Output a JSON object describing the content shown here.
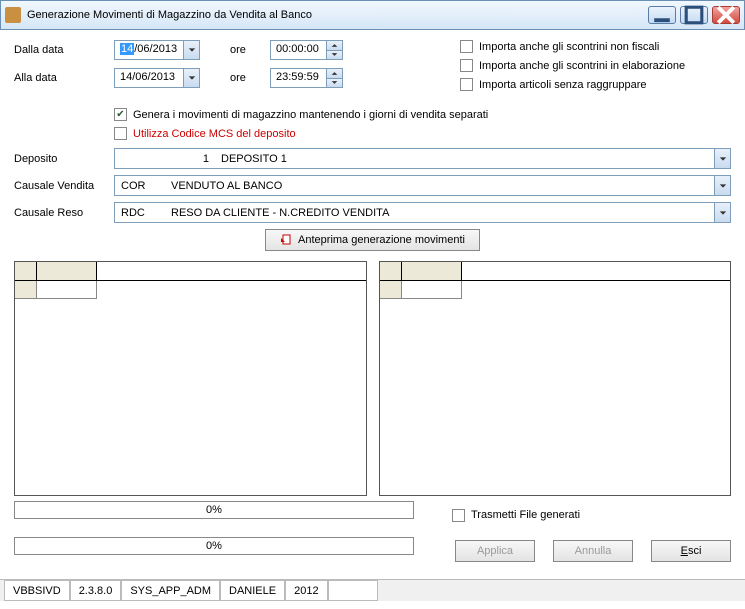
{
  "window": {
    "title": "Generazione Movimenti di Magazzino da Vendita al Banco"
  },
  "dates": {
    "from_label": "Dalla data",
    "from_highlight": "14",
    "from_rest": "/06/2013",
    "to_label": "Alla data",
    "to_value": "14/06/2013",
    "time_label": "ore",
    "time_from": "00:00:00",
    "time_to": "23:59:59"
  },
  "checks": {
    "nonfiscal": "Importa anche gli scontrini non fiscali",
    "elaborazione": "Importa anche gli scontrini in elaborazione",
    "senzaragg": "Importa articoli senza raggruppare",
    "genera": "Genera i movimenti di magazzino mantenendo i giorni di vendita separati",
    "mcs": "Utilizza Codice MCS del deposito",
    "trasmetti": "Trasmetti File generati"
  },
  "deposito": {
    "label": "Deposito",
    "num": "1",
    "text": "DEPOSITO 1"
  },
  "causale_vendita": {
    "label": "Causale Vendita",
    "code": "COR",
    "text": "VENDUTO AL BANCO"
  },
  "causale_reso": {
    "label": "Causale Reso",
    "code": "RDC",
    "text": "RESO DA CLIENTE - N.CREDITO VENDITA"
  },
  "buttons": {
    "anteprima": "Anteprima generazione movimenti",
    "applica": "Applica",
    "annulla": "Annulla",
    "esci_u": "E",
    "esci_rest": "sci"
  },
  "progress": {
    "p1": "0%",
    "p2": "0%"
  },
  "status": {
    "c1": "VBBSIVD",
    "c2": "2.3.8.0",
    "c3": "SYS_APP_ADM",
    "c4": "DANIELE",
    "c5": "2012"
  }
}
